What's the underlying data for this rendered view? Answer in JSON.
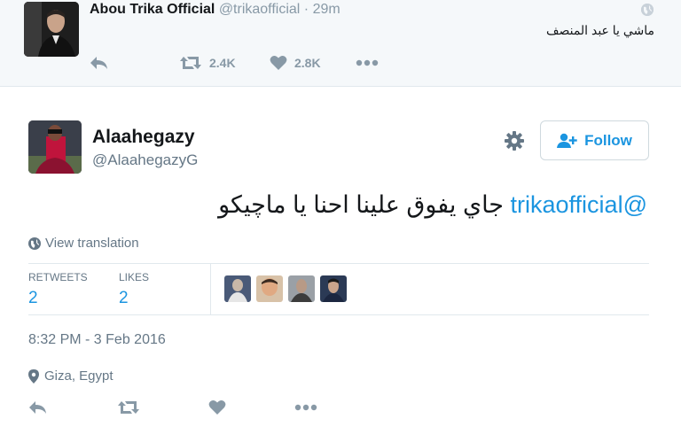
{
  "parent_tweet": {
    "author_name": "Abou Trika Official",
    "author_handle": "@trikaofficial",
    "separator": "·",
    "time_ago": "29m",
    "text": "ماشي يا عبد المنصف",
    "retweet_count": "2.4K",
    "like_count": "2.8K",
    "icons": [
      "reply-icon",
      "retweet-icon",
      "heart-icon",
      "more-icon",
      "globe-icon"
    ]
  },
  "main_tweet": {
    "author_name": "Alaahegazy",
    "author_handle": "@AlaahegazyG",
    "follow_label": "Follow",
    "mention": "@trikaofficial",
    "text": "جاي يفوق علينا احنا يا ماچيكو",
    "view_translation": "View translation",
    "retweets_label": "RETWEETS",
    "retweets_value": "2",
    "likes_label": "LIKES",
    "likes_value": "2",
    "timestamp": "8:32 PM - 3 Feb 2016",
    "location": "Giza, Egypt",
    "icons": [
      "gear-icon",
      "add-user-icon",
      "globe-icon",
      "location-pin-icon",
      "reply-icon",
      "retweet-icon",
      "heart-icon",
      "more-icon"
    ]
  },
  "colors": {
    "accent": "#1b95e0",
    "muted": "#8899a6",
    "text": "#14171a",
    "parent_background": "#f5f8fa"
  }
}
